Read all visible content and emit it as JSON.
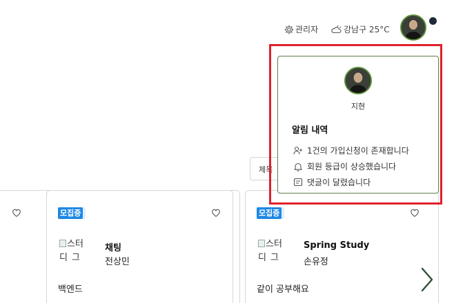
{
  "header": {
    "admin_label": "관리자",
    "weather_label": "강남구 25°C"
  },
  "sort": {
    "label": "제목"
  },
  "cards": [
    {
      "badge": "",
      "title": "",
      "author": "",
      "description": ""
    },
    {
      "badge": "모집중",
      "thumb_alt_line1": "스터",
      "thumb_alt_line2": "디그",
      "title": "채팅",
      "author": "전상민",
      "description": "백엔드"
    },
    {
      "badge": "모집중",
      "thumb_alt_line1": "스터",
      "thumb_alt_line2": "디그",
      "title": "Spring Study",
      "author": "손유정",
      "description": "같이 공부해요"
    }
  ],
  "popup": {
    "user_name": "지현",
    "heading": "알림 내역",
    "notifications": [
      {
        "icon": "user-plus-icon",
        "text": "1건의 가입신청이 존재합니다"
      },
      {
        "icon": "bell-icon",
        "text": "회원 등급이 상승했습니다"
      },
      {
        "icon": "comment-icon",
        "text": "댓글이 달렸습니다"
      }
    ]
  },
  "colors": {
    "badge": "#1e88e5",
    "highlight": "#e0202a",
    "avatar_ring": "#5d8f3a"
  }
}
